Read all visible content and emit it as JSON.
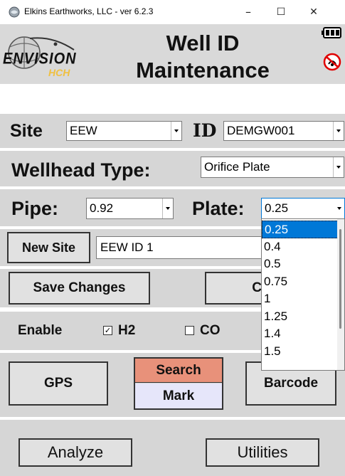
{
  "window": {
    "title": "Elkins Earthworks, LLC - ver 6.2.3",
    "minimize": "–",
    "maximize": "☐",
    "close": "✕"
  },
  "header": {
    "logo_word": "ENVISION",
    "logo_sub": "HCH",
    "title_line1": "Well ID",
    "title_line2": "Maintenance",
    "battery_icon": "battery-icon",
    "no_signal_icon": "no-signal-icon"
  },
  "site": {
    "label": "Site",
    "value": "EEW"
  },
  "id": {
    "label": "ID",
    "value": "DEMGW001"
  },
  "wellhead": {
    "label": "Wellhead Type:",
    "value": "Orifice Plate"
  },
  "pipe": {
    "label": "Pipe:",
    "value": "0.92"
  },
  "plate": {
    "label": "Plate:",
    "value": "0.25",
    "options": [
      "0.25",
      "0.4",
      "0.5",
      "0.75",
      "1",
      "1.25",
      "1.4",
      "1.5"
    ],
    "selected_index": 0
  },
  "new_site": {
    "button": "New Site",
    "value": "EEW ID 1"
  },
  "actions": {
    "save": "Save Changes",
    "clear": "Clear"
  },
  "enable": {
    "label": "Enable",
    "h2": {
      "label": "H2",
      "checked": true
    },
    "co": {
      "label": "CO",
      "checked": false
    }
  },
  "tools": {
    "gps": "GPS",
    "search": "Search",
    "mark": "Mark",
    "barcode": "Barcode"
  },
  "bottom": {
    "analyze": "Analyze",
    "utilities": "Utilities"
  },
  "colors": {
    "search_bg": "#e8917a",
    "mark_bg": "#e6e6fa",
    "highlight": "#0078d7",
    "band": "#d6d6d6"
  }
}
